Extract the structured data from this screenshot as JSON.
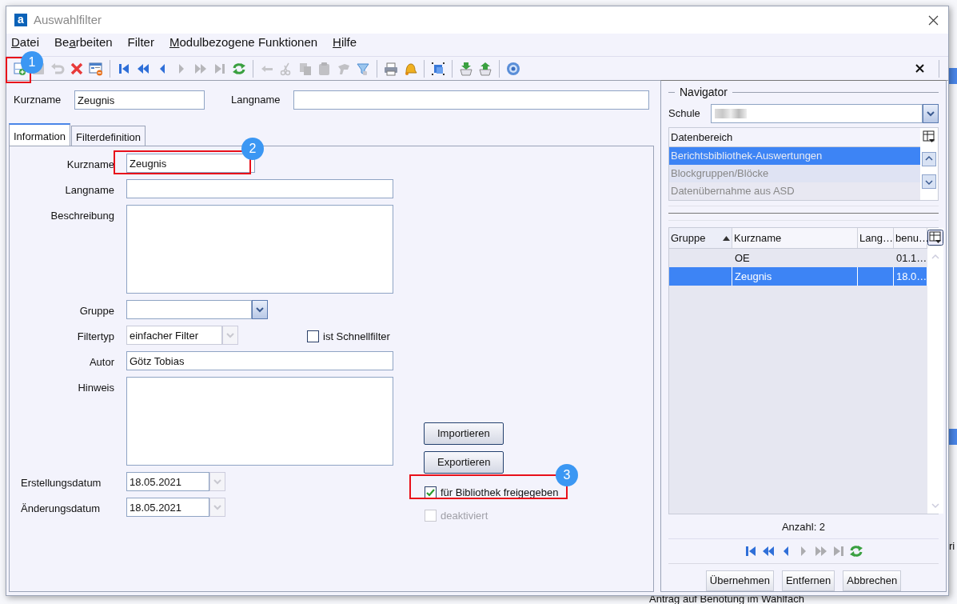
{
  "window": {
    "logo": "a",
    "title": "Auswahlfilter"
  },
  "menu": [
    {
      "key": "D",
      "rest": "atei"
    },
    {
      "before": "Be",
      "key": "a",
      "rest": "rbeiten"
    },
    {
      "label": "Filter"
    },
    {
      "key": "M",
      "rest": "odulbezogene Funktionen"
    },
    {
      "key": "H",
      "rest": "ilfe"
    }
  ],
  "toolbar": [
    {
      "kind": "new",
      "disabled": false
    },
    {
      "kind": "save",
      "disabled": true
    },
    {
      "kind": "undo",
      "disabled": true
    },
    {
      "kind": "delete",
      "disabled": false
    },
    {
      "kind": "form-delete",
      "disabled": false
    },
    {
      "kind": "separator"
    },
    {
      "kind": "first",
      "disabled": false
    },
    {
      "kind": "prev-page",
      "disabled": false
    },
    {
      "kind": "prev",
      "disabled": false
    },
    {
      "kind": "next",
      "disabled": true
    },
    {
      "kind": "next-page",
      "disabled": true
    },
    {
      "kind": "last",
      "disabled": true
    },
    {
      "kind": "refresh",
      "disabled": false
    },
    {
      "kind": "separator"
    },
    {
      "kind": "back",
      "disabled": true
    },
    {
      "kind": "cut",
      "disabled": true
    },
    {
      "kind": "copy",
      "disabled": true
    },
    {
      "kind": "paste",
      "disabled": true
    },
    {
      "kind": "stamp",
      "disabled": true
    },
    {
      "kind": "filter",
      "disabled": false
    },
    {
      "kind": "separator"
    },
    {
      "kind": "print",
      "disabled": false
    },
    {
      "kind": "bell",
      "disabled": false
    },
    {
      "kind": "separator"
    },
    {
      "kind": "select",
      "disabled": false
    },
    {
      "kind": "separator"
    },
    {
      "kind": "import",
      "disabled": false
    },
    {
      "kind": "export",
      "disabled": false
    },
    {
      "kind": "separator"
    },
    {
      "kind": "help",
      "disabled": false
    }
  ],
  "header": {
    "kurzname_label": "Kurzname",
    "kurzname": "Zeugnis",
    "langname_label": "Langname"
  },
  "tabs": [
    {
      "label": "Information",
      "selected": true
    },
    {
      "label": "Filterdefinition",
      "selected": false
    }
  ],
  "form": {
    "kurzname": {
      "label": "Kurzname",
      "value": "Zeugnis"
    },
    "langname": {
      "label": "Langname"
    },
    "beschreibung": {
      "label": "Beschreibung"
    },
    "gruppe": {
      "label": "Gruppe"
    },
    "filtertyp": {
      "label": "Filtertyp",
      "value": "einfacher Filter",
      "disabled": true
    },
    "schnellfilter": {
      "label": "ist Schnellfilter",
      "checked": false
    },
    "autor": {
      "label": "Autor",
      "value": "Götz Tobias"
    },
    "hinweis": {
      "label": "Hinweis"
    },
    "erstellungsdatum": {
      "label": "Erstellungsdatum",
      "value": "18.05.2021"
    },
    "aenderungsdatum": {
      "label": "Änderungsdatum",
      "value": "18.05.2021"
    },
    "buttons": [
      "Importieren",
      "Exportieren"
    ],
    "bibliothek": {
      "label": "für Bibliothek freigegeben",
      "checked": true,
      "disabled": false
    },
    "deaktiviert": {
      "label": "deaktiviert",
      "checked": false,
      "disabled": true
    }
  },
  "navigator": {
    "title": "Navigator",
    "schule_label": "Schule",
    "datenbereich": {
      "header": "Datenbereich",
      "items": [
        {
          "label": "Berichtsbibliothek-Auswertungen",
          "selected": true
        },
        {
          "label": "Blockgruppen/Blöcke",
          "selected": false
        },
        {
          "label": "Datenübernahme aus ASD",
          "selected": false
        }
      ]
    },
    "table": {
      "columns": [
        {
          "label": "Gruppe",
          "sorted": true
        },
        {
          "label": "Kurzname"
        },
        {
          "label": "Lang…"
        },
        {
          "label": "benu…"
        }
      ],
      "rows": [
        {
          "cells": [
            null,
            "OE",
            null,
            "01.1…"
          ],
          "selected": false
        },
        {
          "cells": [
            null,
            "Zeugnis",
            null,
            "18.0…"
          ],
          "selected": true
        }
      ]
    },
    "count": "Anzahl: 2",
    "pager": [
      {
        "kind": "first",
        "disabled": false
      },
      {
        "kind": "prev-page",
        "disabled": false
      },
      {
        "kind": "prev",
        "disabled": false
      },
      {
        "kind": "next",
        "disabled": true
      },
      {
        "kind": "next-page",
        "disabled": true
      },
      {
        "kind": "last",
        "disabled": true
      },
      {
        "kind": "refresh",
        "disabled": false
      }
    ],
    "buttons": [
      "Übernehmen",
      "Entfernen",
      "Abbrechen"
    ]
  },
  "annotations": [
    {
      "number": "1"
    },
    {
      "number": "2"
    },
    {
      "number": "3"
    }
  ],
  "background": {
    "row_text": "Antrag auf Benotung im Wahlfach",
    "edge_text": "ri"
  }
}
